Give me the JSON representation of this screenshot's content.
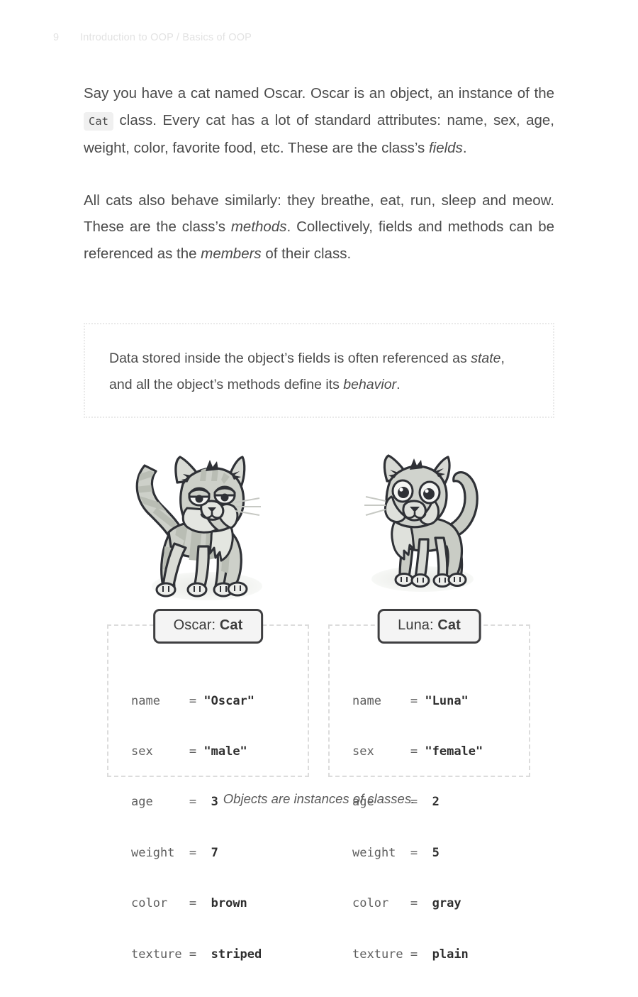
{
  "page": {
    "folio": "9",
    "running_head": "Introduction to OOP / Basics of OOP"
  },
  "paragraphs": {
    "p1_part1": "Say you have a cat named Oscar. Oscar is an object, an instance of the ",
    "p1_code": "Cat",
    "p1_part2": " class. Every cat has a lot of standard attributes: name, sex, age, weight, color, favorite food, etc. These are the class’s ",
    "p1_em": "fields",
    "p1_part3": ".",
    "p2_part1": "All cats also behave similarly: they breathe, eat, run, sleep and meow. These are the class’s ",
    "p2_em1": "methods",
    "p2_part2": ". Collectively, fields and methods can be referenced as the ",
    "p2_em2": "members",
    "p2_part3": " of their class."
  },
  "callout": {
    "part1": "Data stored inside the object’s fields is often referenced as ",
    "em1": "state",
    "part2": ", and all the object’s methods define its ",
    "em2": "behavior",
    "part3": "."
  },
  "figure": {
    "caption": "Objects are instances of classes.",
    "objects": [
      {
        "instance": "Oscar",
        "separator": ": ",
        "class": "Cat",
        "fields": [
          {
            "key": "name   ",
            "eq": " = ",
            "value": "\"Oscar\""
          },
          {
            "key": "sex    ",
            "eq": " = ",
            "value": "\"male\""
          },
          {
            "key": "age    ",
            "eq": " = ",
            "value": " 3"
          },
          {
            "key": "weight ",
            "eq": " = ",
            "value": " 7"
          },
          {
            "key": "color  ",
            "eq": " = ",
            "value": " brown"
          },
          {
            "key": "texture",
            "eq": " = ",
            "value": " striped"
          }
        ]
      },
      {
        "instance": "Luna",
        "separator": ": ",
        "class": "Cat",
        "fields": [
          {
            "key": "name   ",
            "eq": " = ",
            "value": "\"Luna\""
          },
          {
            "key": "sex    ",
            "eq": " = ",
            "value": "\"female\""
          },
          {
            "key": "age    ",
            "eq": " = ",
            "value": " 2"
          },
          {
            "key": "weight ",
            "eq": " = ",
            "value": " 5"
          },
          {
            "key": "color  ",
            "eq": " = ",
            "value": " gray"
          },
          {
            "key": "texture",
            "eq": " = ",
            "value": " plain"
          }
        ]
      }
    ],
    "illustrations": [
      {
        "name": "oscar-striped-cat",
        "texture": "striped",
        "color": "#c9ccc5"
      },
      {
        "name": "luna-plain-cat",
        "texture": "plain",
        "color": "#c9ccc5"
      }
    ]
  },
  "colors": {
    "text": "#4b4b4b",
    "running_head": "#e2e2e2",
    "code_bg": "#f0f0f0",
    "box_border": "#dcdcdc",
    "title_border": "#3f3f41",
    "title_bg": "#f4f4f4",
    "cat_body": "#cdd0c9",
    "cat_outline": "#2f3136",
    "shadow": "#eceeea"
  }
}
